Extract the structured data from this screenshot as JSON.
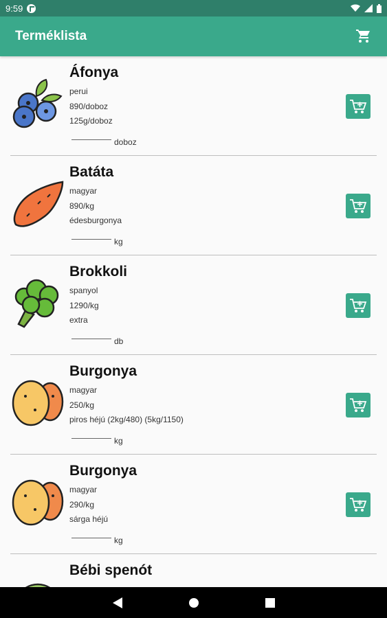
{
  "status": {
    "time": "9:59"
  },
  "appbar": {
    "title": "Terméklista"
  },
  "products": [
    {
      "name": "Áfonya",
      "origin": "perui",
      "price": "890/doboz",
      "note": "125g/doboz",
      "unit": "doboz",
      "icon": "blueberry-icon"
    },
    {
      "name": "Batáta",
      "origin": "magyar",
      "price": "890/kg",
      "note": "édesburgonya",
      "unit": "kg",
      "icon": "sweet-potato-icon"
    },
    {
      "name": "Brokkoli",
      "origin": "spanyol",
      "price": "1290/kg",
      "note": "extra",
      "unit": "db",
      "icon": "broccoli-icon"
    },
    {
      "name": "Burgonya",
      "origin": "magyar",
      "price": "250/kg",
      "note": "piros héjú (2kg/480) (5kg/1150)",
      "unit": "kg",
      "icon": "potato-icon"
    },
    {
      "name": "Burgonya",
      "origin": "magyar",
      "price": "290/kg",
      "note": "sárga héjú",
      "unit": "kg",
      "icon": "potato-icon"
    }
  ],
  "partial_item": {
    "name": "Bébi spenót"
  },
  "colors": {
    "primary": "#3aa98b",
    "status": "#2f7f6a"
  }
}
